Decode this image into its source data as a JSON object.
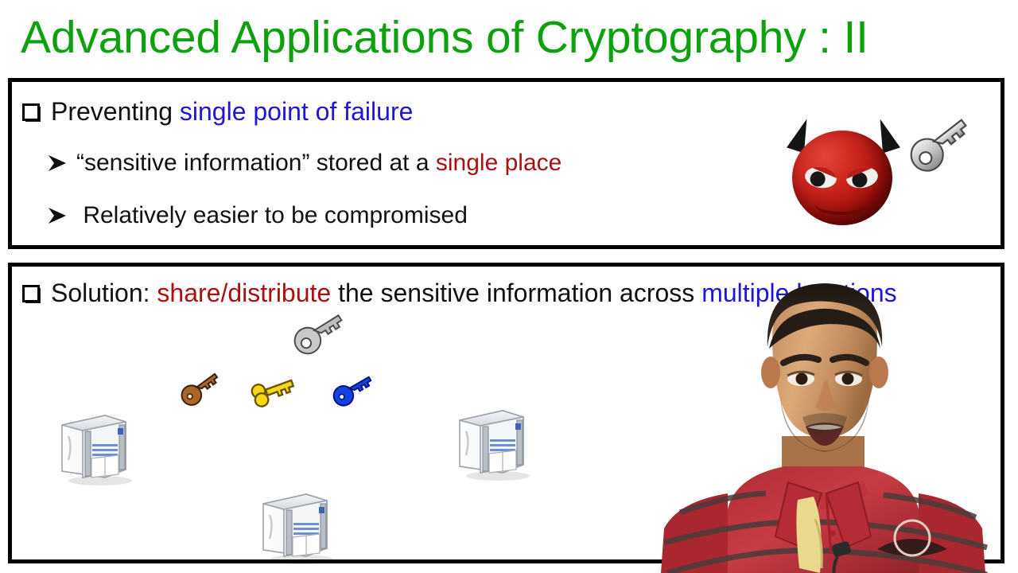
{
  "slide": {
    "title": "Advanced Applications of Cryptography : II",
    "title_color": "#0DA10D",
    "background": "#ffffff"
  },
  "panels": [
    {
      "id": "panel-top",
      "border_color": "#000000",
      "bullets": [
        {
          "marker": "square-bullet",
          "level": 1,
          "segments": [
            {
              "text": "Preventing ",
              "color": "#111111"
            },
            {
              "text": "single point of failure",
              "color": "#1F15D6"
            }
          ]
        },
        {
          "marker": "arrow-bullet",
          "level": 2,
          "segments": [
            {
              "text": "“sensitive information” stored at a ",
              "color": "#111111"
            },
            {
              "text": "single place",
              "color": "#A81111"
            }
          ]
        },
        {
          "marker": "arrow-bullet",
          "level": 2,
          "segments": [
            {
              "text": " Relatively easier to be compromised",
              "color": "#111111"
            }
          ]
        }
      ],
      "graphics": [
        {
          "name": "devil-emoji",
          "color": "#b81410",
          "label": "red devil face with horns"
        },
        {
          "name": "key-icon-gray",
          "color": "#b9b9b9",
          "label": "gray key"
        }
      ]
    },
    {
      "id": "panel-bottom",
      "border_color": "#000000",
      "bullets": [
        {
          "marker": "square-bullet",
          "level": 1,
          "segments": [
            {
              "text": "Solution: ",
              "color": "#111111"
            },
            {
              "text": "share/distribute",
              "color": "#A81111"
            },
            {
              "text": " the sensitive information across ",
              "color": "#111111"
            },
            {
              "text": "multiple locations",
              "color": "#1F15D6"
            }
          ]
        }
      ],
      "graphics": [
        {
          "name": "key-icon-gray",
          "color": "#b9b9b9",
          "label": "gray key"
        },
        {
          "name": "key-icon-brown",
          "color": "#a8662a",
          "label": "brown key"
        },
        {
          "name": "key-icon-yellow",
          "color": "#f5d913",
          "label": "yellow key"
        },
        {
          "name": "key-icon-blue",
          "color": "#1442e0",
          "label": "blue key"
        },
        {
          "name": "server-icon",
          "color": "#e7eaee",
          "label": "computer tower / server"
        },
        {
          "name": "server-icon",
          "color": "#e7eaee",
          "label": "computer tower / server"
        },
        {
          "name": "server-icon",
          "color": "#e7eaee",
          "label": "computer tower / server"
        }
      ]
    }
  ],
  "presenter": {
    "name": "presenter-video-overlay",
    "shirt_color": "#c2333d",
    "collar_color": "#e8d98a",
    "description": "lecturer speaking, red striped polo shirt with clip-on microphone"
  }
}
